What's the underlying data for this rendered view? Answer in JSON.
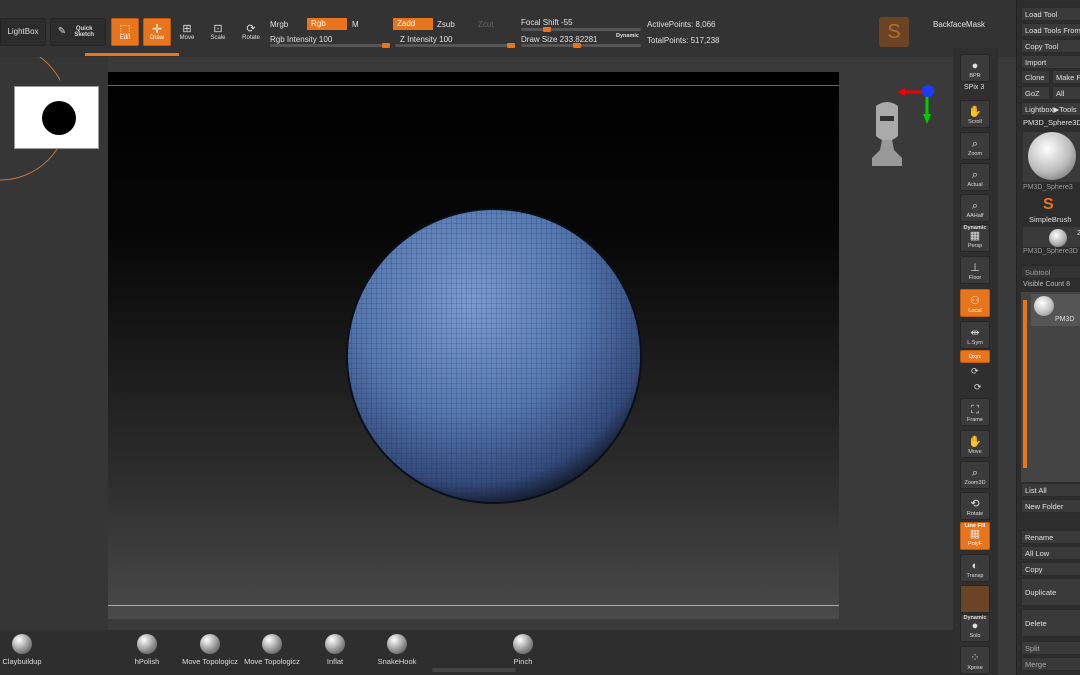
{
  "top": {
    "lightbox": "LightBox",
    "quick_sketch": "Quick Sketch",
    "edit": "Edit",
    "draw": "Draw",
    "move": "Move",
    "scale": "Scale",
    "rotate": "Rotate",
    "mrgb": "Mrgb",
    "rgb": "Rgb",
    "m": "M",
    "rgb_intensity": "Rgb Intensity 100",
    "zadd": "Zadd",
    "zsub": "Zsub",
    "zcut": "Zcut",
    "z_intensity": "Z Intensity 100",
    "focal_shift": "Focal Shift -55",
    "draw_size": "Draw Size 233.82281",
    "dynamic": "Dynamic",
    "active_points": "ActivePoints: 8,066",
    "total_points": "TotalPoints: 517,238",
    "backface_mask": "BackfaceMask"
  },
  "shelf": {
    "bpr": "BPR",
    "spix": "SPix 3",
    "scroll": "Scroll",
    "zoom": "Zoom",
    "actual": "Actual",
    "aahalf": "AAHalf",
    "persp": "Persp",
    "dynamic": "Dynamic",
    "floor": "Floor",
    "local": "Local",
    "lsym": "L.Sym",
    "xyz": "Qxyz",
    "frame": "Frame",
    "move": "Move",
    "zoom3d": "Zoom3D",
    "rotate": "Rotate",
    "line_fill": "Line Fill",
    "polyf": "PolyF",
    "transp": "Transp",
    "dynamic2": "Dynamic",
    "solo": "Solo",
    "xpose": "Xpose"
  },
  "tray": {
    "load_tool": "Load Tool",
    "load_tools_from": "Load Tools From",
    "copy_tool": "Copy Tool",
    "import": "Import",
    "clone": "Clone",
    "make_p": "Make P",
    "goz": "GoZ",
    "all": "All",
    "lightbox_tools": "Lightbox▶Tools",
    "pm3d_sphere3d": "PM3D_Sphere3D",
    "pm3d_sphere_small": "PM3D_Sphere3",
    "simple_brush": "SimpleBrush",
    "pm3d_sphere_2": "PM3D_Sphere3D",
    "num2": "2",
    "subtool": "Subtool",
    "visible_count": "Visible Count 8",
    "pm3d_sub": "PM3D",
    "list_all": "List All",
    "new_folder": "New Folder",
    "rename": "Rename",
    "all_low": "All Low",
    "copy": "Copy",
    "duplicate": "Duplicate",
    "delete": "Delete",
    "split": "Split",
    "merge": "Merge"
  },
  "brushes": [
    "Claybuildup",
    "hPolish",
    "Move Topologicz",
    "Move Topologicz",
    "Inflat",
    "SnakeHook",
    "Pinch"
  ],
  "colors": {
    "accent": "#e8741c",
    "mesh": "#5577b0",
    "panel": "#333333"
  }
}
